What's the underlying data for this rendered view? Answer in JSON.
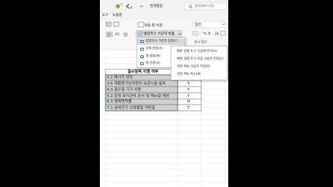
{
  "ribbon": {
    "tab_left": "도구",
    "tab_help": "도움말",
    "file_title": "전체통합",
    "search_placeholder": "검색(Alt+Q)",
    "wrap_text": "자동 줄 바꿈",
    "merge_center": "병합하고 가운데 맞춤",
    "number_format": "일반",
    "cond_format_hint": "표시 형식"
  },
  "merge_menu": {
    "items": [
      "병합하고 가운데 맞춤(C)",
      "전체 병합(A)",
      "셀 병합(M)",
      "셀 분할(U)"
    ]
  },
  "context_menu": {
    "items": [
      "빠른 실행 도구 모음에 추가(A)",
      "빠른 실행 도구 모음 사용자 지정(C)",
      "리본 메뉴 사용자 지정(R)",
      "리본 메뉴 축소(N)"
    ]
  },
  "sheet": {
    "header": "필수항목 이행 여부",
    "rows": [
      {
        "label": "2.1 에너지 성능",
        "value": "Y"
      },
      {
        "label": "3.6 재활용가능자원의 보관시설 설치",
        "value": "Y"
      },
      {
        "label": "4.3 절수형 기기 사용",
        "value": "Y"
      },
      {
        "label": "5.2 운영 유지관리 문서 및 매뉴얼 제공",
        "value": "Y"
      },
      {
        "label": "6.3 생태면적률",
        "value": "N"
      },
      {
        "label": "7.1 실내공기 오염물질 저방출",
        "value": "Y"
      }
    ]
  },
  "colors": {
    "selection_fill": "#cfcfcf",
    "menu_highlight": "#d9d9d9",
    "accent_green": "#2e7d32"
  }
}
